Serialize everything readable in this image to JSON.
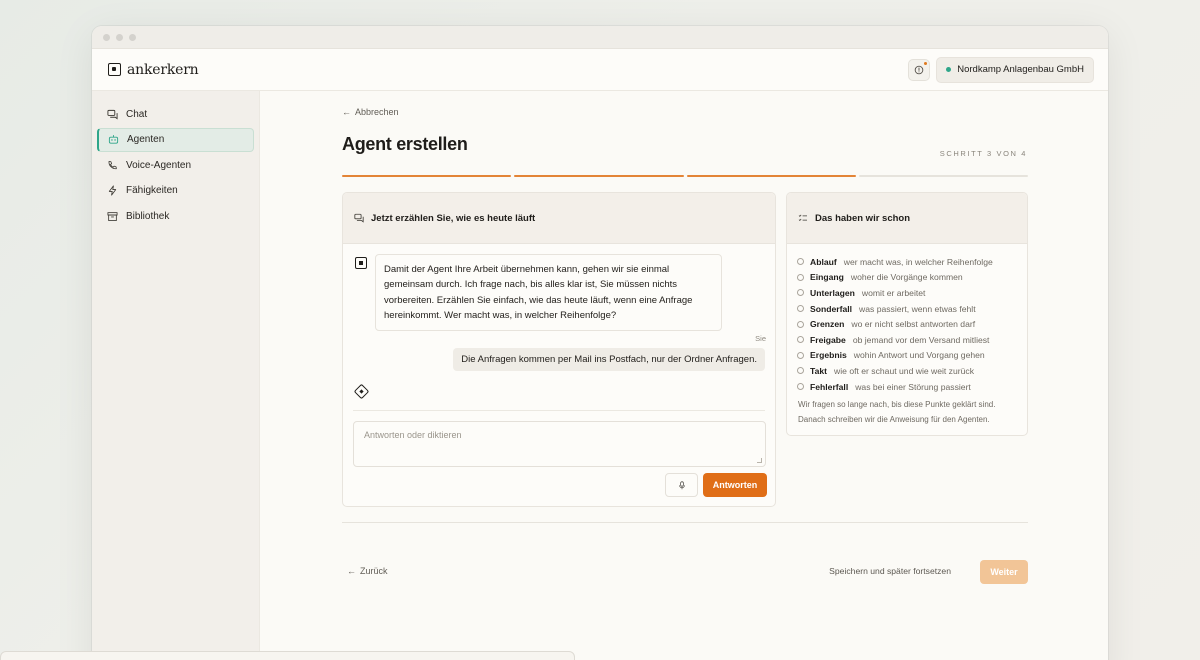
{
  "app": {
    "name": "ankerkern"
  },
  "header": {
    "org_name": "Nordkamp Anlagenbau GmbH"
  },
  "sidebar": {
    "items": [
      {
        "label": "Chat",
        "icon": "chat-icon"
      },
      {
        "label": "Agenten",
        "icon": "robot-icon",
        "active": true
      },
      {
        "label": "Voice-Agenten",
        "icon": "phone-icon"
      },
      {
        "label": "Fähigkeiten",
        "icon": "lightning-icon"
      },
      {
        "label": "Bibliothek",
        "icon": "archive-icon"
      }
    ]
  },
  "page": {
    "back_label": "Abbrechen",
    "title": "Agent erstellen",
    "step_label": "SCHRITT 3 VON 4",
    "progress": {
      "current": 3,
      "total": 4
    }
  },
  "chat": {
    "title": "Jetzt erzählen Sie, wie es heute läuft",
    "agent_message": "Damit der Agent Ihre Arbeit übernehmen kann, gehen wir sie einmal gemeinsam durch. Ich frage nach, bis alles klar ist, Sie müssen nichts vorbereiten. Erzählen Sie einfach, wie das heute läuft, wenn eine Anfrage hereinkommt. Wer macht was, in welcher Reihenfolge?",
    "user_label": "Sie",
    "user_message": "Die Anfragen kommen per Mail ins Postfach, nur der Ordner Anfragen.",
    "input_placeholder": "Antworten oder diktieren",
    "send_label": "Antworten"
  },
  "summary": {
    "title": "Das haben wir schon",
    "items": [
      {
        "term": "Ablauf",
        "desc": "wer macht was, in welcher Reihenfolge"
      },
      {
        "term": "Eingang",
        "desc": "woher die Vorgänge kommen"
      },
      {
        "term": "Unterlagen",
        "desc": "womit er arbeitet"
      },
      {
        "term": "Sonderfall",
        "desc": "was passiert, wenn etwas fehlt"
      },
      {
        "term": "Grenzen",
        "desc": "wo er nicht selbst antworten darf"
      },
      {
        "term": "Freigabe",
        "desc": "ob jemand vor dem Versand mitliest"
      },
      {
        "term": "Ergebnis",
        "desc": "wohin Antwort und Vorgang gehen"
      },
      {
        "term": "Takt",
        "desc": "wie oft er schaut und wie weit zurück"
      },
      {
        "term": "Fehlerfall",
        "desc": "was bei einer Störung passiert"
      }
    ],
    "note": "Wir fragen so lange nach, bis diese Punkte geklärt sind. Danach schreiben wir die Anweisung für den Agenten."
  },
  "footer": {
    "back_label": "Zurück",
    "save_later_label": "Speichern und später fortsetzen",
    "next_label": "Weiter"
  },
  "colors": {
    "accent": "#e06e17",
    "active_nav": "#2fa68a",
    "status_dot": "#2fa68a"
  }
}
